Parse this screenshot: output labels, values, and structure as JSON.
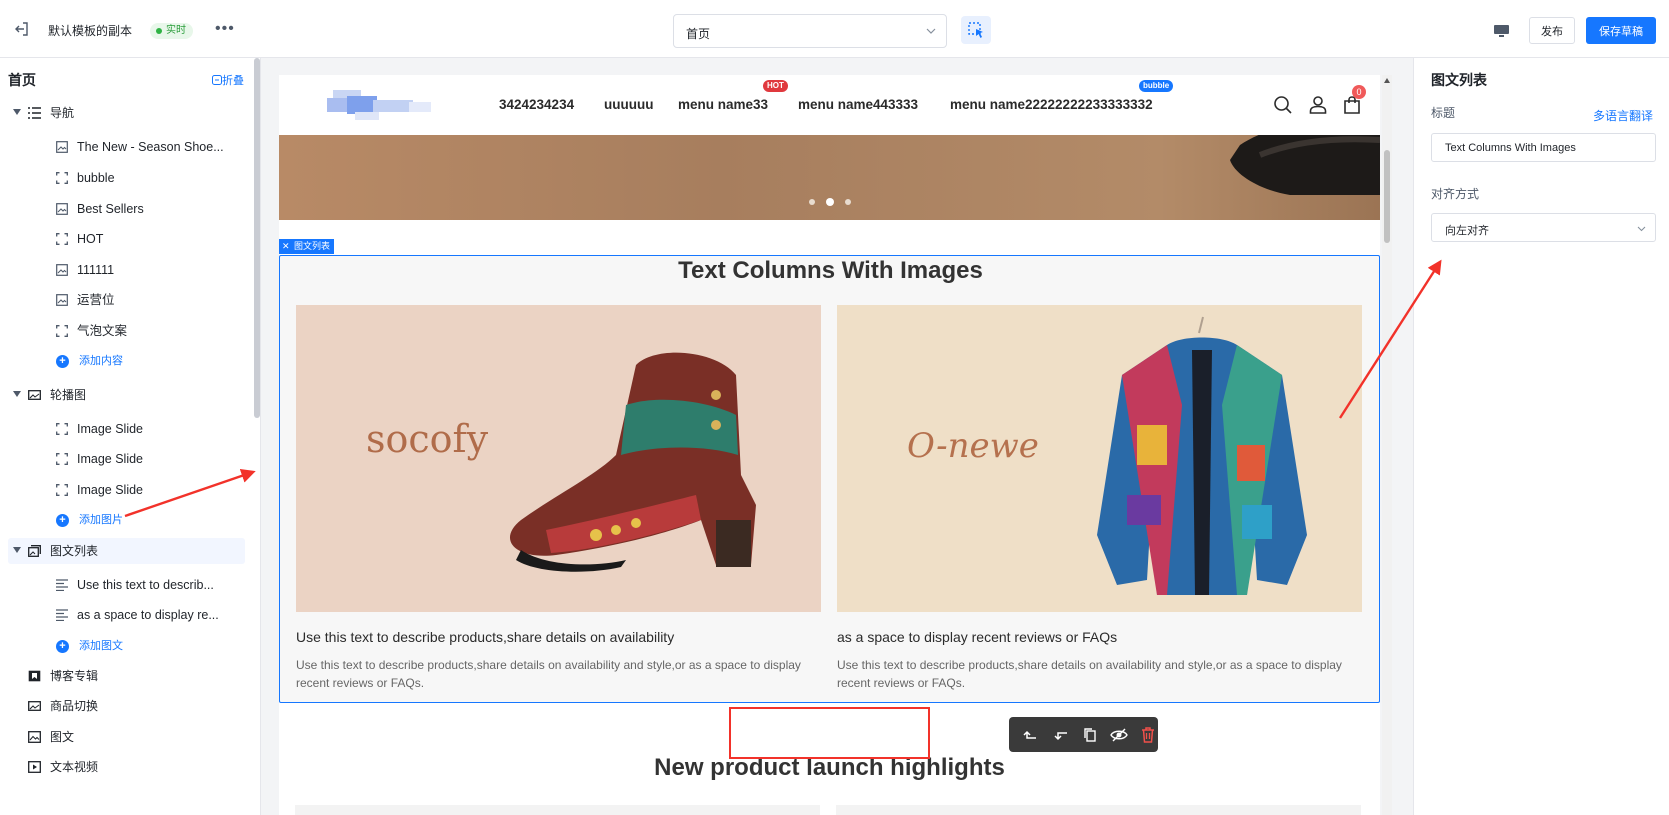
{
  "topbar": {
    "title": "默认模板的副本",
    "badge": "实时",
    "more": "•••",
    "page_select": "首页",
    "publish": "发布",
    "save_draft": "保存草稿"
  },
  "left_panel": {
    "heading": "首页",
    "collapse": "折叠",
    "groups": [
      {
        "label": "导航",
        "items": [
          "The New - Season Shoe...",
          "bubble",
          "Best Sellers",
          "HOT",
          "111111",
          "运营位",
          "气泡文案"
        ],
        "add": "添加内容"
      },
      {
        "label": "轮播图",
        "items": [
          "Image Slide",
          "Image Slide",
          "Image Slide"
        ],
        "add": "添加图片"
      },
      {
        "label": "图文列表",
        "items": [
          "Use this text to describ...",
          "as a space to display re..."
        ],
        "add": "添加图文"
      }
    ],
    "other_groups": [
      "博客专辑",
      "商品切换",
      "图文",
      "文本视频"
    ]
  },
  "canvas": {
    "nav": {
      "items": [
        "3424234234",
        "uuuuuu",
        "menu name33",
        "menu name443333",
        "menu name22222222233333332"
      ],
      "hot_badge": "HOT",
      "bubble_badge": "bubble",
      "cart_count": "0"
    },
    "section_tag": "图文列表",
    "section_title": "Text Columns With Images",
    "columns": [
      {
        "brand": "socofy",
        "heading": "Use this text to describe products,share details on availability",
        "text": "Use this text to describe products,share details on availability and style,or as a space to display recent reviews or FAQs."
      },
      {
        "brand": "O-newe",
        "heading": "as a space to display recent reviews or FAQs",
        "text": "Use this text to describe products,share details on availability and style,or as a space to display recent reviews or FAQs."
      }
    ],
    "next_section_title": "New product launch highlights"
  },
  "right_panel": {
    "title": "图文列表",
    "title_label": "标题",
    "translate_link": "多语言翻译",
    "title_value": "Text Columns With Images",
    "align_label": "对齐方式",
    "align_value": "向左对齐"
  },
  "colors": {
    "accent": "#1677ff",
    "danger": "#e0393e",
    "annotation": "#f2322a"
  }
}
